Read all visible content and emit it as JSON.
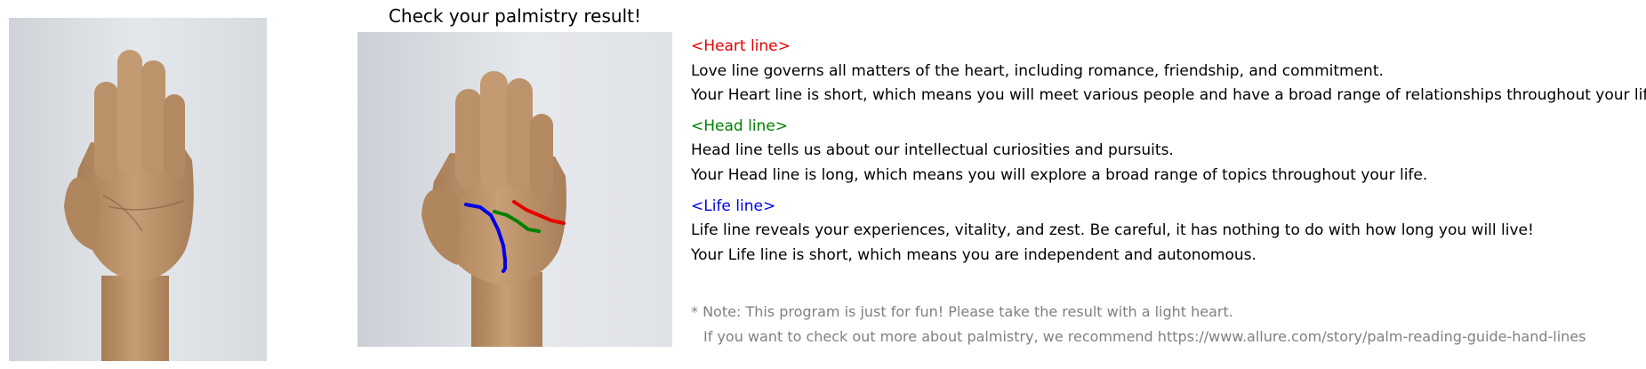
{
  "title": "Check your palmistry result!",
  "sections": {
    "heart": {
      "heading": "<Heart line>",
      "color": "#e60000",
      "desc": "Love line governs all matters of the heart, including romance, friendship, and commitment.",
      "result": "Your Heart line is short, which means you will meet various people and have a broad range of relationships throughout your life."
    },
    "head": {
      "heading": "<Head line>",
      "color": "#008000",
      "desc": "Head line tells us about our intellectual curiosities and pursuits.",
      "result": "Your Head line is long, which means you will explore a broad range of topics throughout your life."
    },
    "life": {
      "heading": "<Life line>",
      "color": "#0000e6",
      "desc": "Life line reveals your experiences, vitality, and zest. Be careful, it has nothing to do with how long you will live!",
      "result": "Your Life line is short, which means you are independent and autonomous."
    }
  },
  "note": {
    "line1": "* Note: This program is just for fun! Please take the result with a light heart.",
    "line2": "If you want to check out more about palmistry, we recommend https://www.allure.com/story/palm-reading-guide-hand-lines",
    "color": "#808080"
  }
}
